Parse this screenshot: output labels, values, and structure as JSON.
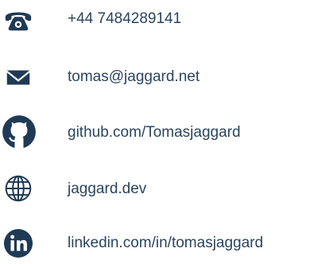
{
  "contacts": [
    {
      "icon": "phone-icon",
      "text": "+44 7484289141"
    },
    {
      "icon": "envelope-icon",
      "text": "tomas@jaggard.net"
    },
    {
      "icon": "github-icon",
      "text": "github.com/Tomasjaggard"
    },
    {
      "icon": "globe-icon",
      "text": "jaggard.dev"
    },
    {
      "icon": "linkedin-icon",
      "text": "linkedin.com/in/tomasjaggard"
    }
  ],
  "colors": {
    "icon": "#1f3a55",
    "text": "#2a4560",
    "background": "#ffffff"
  }
}
